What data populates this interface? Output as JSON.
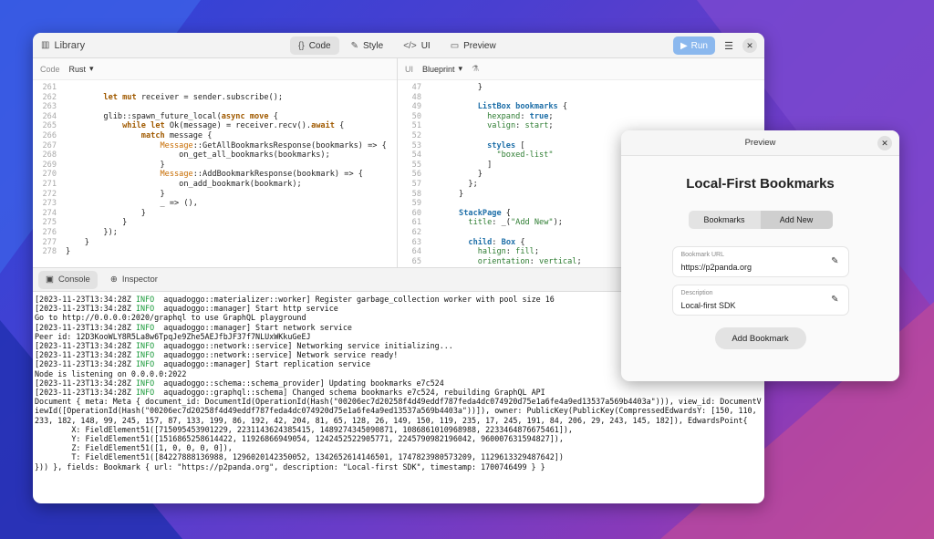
{
  "main_window": {
    "library_label": "Library",
    "tabs": [
      {
        "icon": "braces-icon",
        "glyph": "{}",
        "label": "Code",
        "active": true
      },
      {
        "icon": "brush-icon",
        "glyph": "✎",
        "label": "Style",
        "active": false
      },
      {
        "icon": "ui-tag-icon",
        "glyph": "</>",
        "label": "UI",
        "active": false
      },
      {
        "icon": "preview-window-icon",
        "glyph": "▭",
        "label": "Preview",
        "active": false
      }
    ],
    "run_label": "Run"
  },
  "code_pane": {
    "label": "Code",
    "language": "Rust",
    "lines": [
      {
        "n": "261",
        "html": ""
      },
      {
        "n": "262",
        "html": "        <span class='kw'>let</span> <span class='kw'>mut</span> receiver = sender.subscribe();"
      },
      {
        "n": "263",
        "html": ""
      },
      {
        "n": "264",
        "html": "        glib::spawn_future_local(<span class='kw'>async</span> <span class='kw'>move</span> {"
      },
      {
        "n": "265",
        "html": "            <span class='kw'>while</span> <span class='kw'>let</span> Ok(message) = receiver.recv().<span class='kw'>await</span> {"
      },
      {
        "n": "266",
        "html": "                <span class='kw'>match</span> message {"
      },
      {
        "n": "267",
        "html": "                    <span class='ty'>Message</span>::GetAllBookmarksResponse(bookmarks) =&gt; {"
      },
      {
        "n": "268",
        "html": "                        on_get_all_bookmarks(bookmarks);"
      },
      {
        "n": "269",
        "html": "                    }"
      },
      {
        "n": "270",
        "html": "                    <span class='ty'>Message</span>::AddBookmarkResponse(bookmark) =&gt; {"
      },
      {
        "n": "271",
        "html": "                        on_add_bookmark(bookmark);"
      },
      {
        "n": "272",
        "html": "                    }"
      },
      {
        "n": "273",
        "html": "                    _ =&gt; (),"
      },
      {
        "n": "274",
        "html": "                }"
      },
      {
        "n": "275",
        "html": "            }"
      },
      {
        "n": "276",
        "html": "        });"
      },
      {
        "n": "277",
        "html": "    }"
      },
      {
        "n": "278",
        "html": "}"
      }
    ]
  },
  "ui_pane": {
    "label": "UI",
    "language": "Blueprint",
    "lines": [
      {
        "n": "47",
        "html": "          }"
      },
      {
        "n": "48",
        "html": ""
      },
      {
        "n": "49",
        "html": "          <span class='bp'>ListBox</span> <span class='bp'>bookmarks</span> {"
      },
      {
        "n": "50",
        "html": "            <span class='pr'>hexpand</span>: <span class='bp'>true</span>;"
      },
      {
        "n": "51",
        "html": "            <span class='pr'>valign</span>: <span class='pr'>start</span>;"
      },
      {
        "n": "52",
        "html": ""
      },
      {
        "n": "53",
        "html": "            <span class='bp'>styles</span> ["
      },
      {
        "n": "54",
        "html": "              <span class='st'>\"boxed-list\"</span>"
      },
      {
        "n": "55",
        "html": "            ]"
      },
      {
        "n": "56",
        "html": "          }"
      },
      {
        "n": "57",
        "html": "        };"
      },
      {
        "n": "58",
        "html": "      }"
      },
      {
        "n": "59",
        "html": ""
      },
      {
        "n": "60",
        "html": "      <span class='bp'>StackPage</span> {"
      },
      {
        "n": "61",
        "html": "        <span class='pr'>title</span>: _(<span class='st'>\"Add New\"</span>);"
      },
      {
        "n": "62",
        "html": ""
      },
      {
        "n": "63",
        "html": "        <span class='bp'>child</span>: <span class='bp'>Box</span> {"
      },
      {
        "n": "64",
        "html": "          <span class='pr'>halign</span>: <span class='pr'>fill</span>;"
      },
      {
        "n": "65",
        "html": "          <span class='pr'>orientation</span>: <span class='pr'>vertical</span>;"
      }
    ]
  },
  "bottom_tabs": [
    {
      "icon": "console-icon",
      "glyph": "▣",
      "label": "Console",
      "active": true
    },
    {
      "icon": "inspector-icon",
      "glyph": "⊕",
      "label": "Inspector",
      "active": false
    }
  ],
  "console_lines": [
    "[2023-11-23T13:34:28Z <span class='info'>INFO</span>  aquadoggo::materializer::worker] Register garbage_collection worker with pool size 16",
    "[2023-11-23T13:34:28Z <span class='info'>INFO</span>  aquadoggo::manager] Start http service",
    "Go to http://0.0.0.0:2020/graphql to use GraphQL playground",
    "[2023-11-23T13:34:28Z <span class='info'>INFO</span>  aquadoggo::manager] Start network service",
    "Peer id: 12D3KooWLY8R5La8w6TpqJe9Zhe5AEJfbJF37f7NLUxWKkuGeEJ",
    "[2023-11-23T13:34:28Z <span class='info'>INFO</span>  aquadoggo::network::service] Networking service initializing...",
    "[2023-11-23T13:34:28Z <span class='info'>INFO</span>  aquadoggo::network::service] Network service ready!",
    "[2023-11-23T13:34:28Z <span class='info'>INFO</span>  aquadoggo::manager] Start replication service",
    "Node is listening on 0.0.0.0:2022",
    "[2023-11-23T13:34:28Z <span class='info'>INFO</span>  aquadoggo::schema::schema_provider] Updating bookmarks e7c524",
    "[2023-11-23T13:34:28Z <span class='info'>INFO</span>  aquadoggo::graphql::schema] Changed schema bookmarks e7c524, rebuilding GraphQL API",
    "Document { meta: Meta { document_id: DocumentId(OperationId(Hash(\"00206ec7d20258f4d49eddf787feda4dc074920d75e1a6fe4a9ed13537a569b4403a\"))), view_id: DocumentViewId([OperationId(Hash(\"00206ec7d20258f4d49eddf787feda4dc074920d75e1a6fe4a9ed13537a569b4403a\"))]), owner: PublicKey(PublicKey(CompressedEdwardsY: [150, 110, 233, 182, 148, 99, 245, 157, 87, 133, 199, 86, 192, 42, 204, 81, 65, 128, 26, 149, 150, 119, 235, 17, 245, 191, 84, 206, 29, 243, 145, 182]), EdwardsPoint{",
    "        X: FieldElement51([715095453901229, 2231143624385415, 1489274345090871, 1086861010968988, 2233464876675461]),",
    "        Y: FieldElement51([1516865258614422, 1192686694905​4, 1242452522905771, 2245790982196042, 960007631594827]),",
    "        Z: FieldElement51([1, 0, 0, 0, 0]),",
    "        T: FieldElement51([84227888136988, 1296020142350052, 1342652614146501, 1747823980573209, 1129613329487642])",
    "})) }, fields: Bookmark { url: \"https://p2panda.org\", description: \"Local-first SDK\", timestamp: 1700746499 } }"
  ],
  "preview": {
    "window_title": "Preview",
    "app_title": "Local-First Bookmarks",
    "seg_bookmarks": "Bookmarks",
    "seg_add_new": "Add New",
    "url_label": "Bookmark URL",
    "url_value": "https://p2panda.org",
    "desc_label": "Description",
    "desc_value": "Local-first SDK",
    "add_button": "Add Bookmark"
  }
}
